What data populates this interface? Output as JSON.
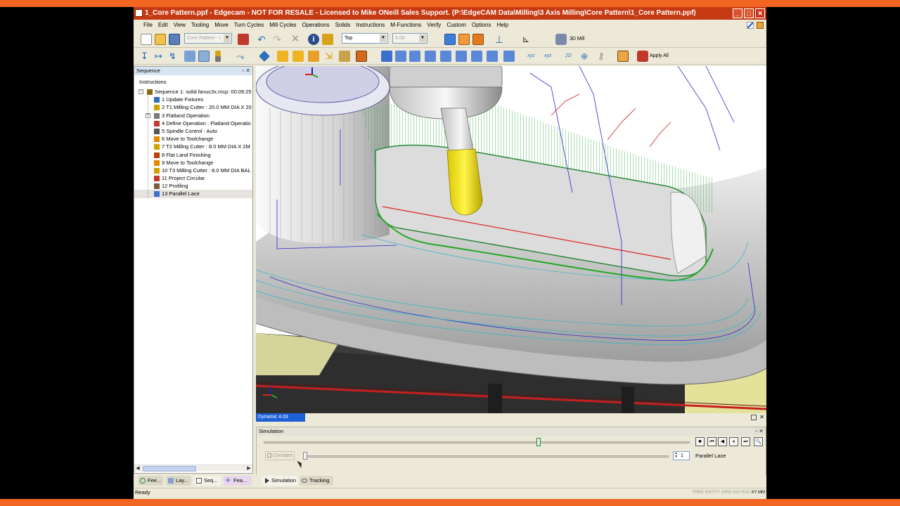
{
  "window": {
    "title": "1_Core Pattern.ppf - Edgecam - NOT FOR RESALE - Licensed to Mike ONeill Sales Support. (P:\\EdgeCAM Data\\Milling\\3 Axis Milling\\Core Pattern\\1_Core Pattern.ppf)",
    "min": "_",
    "max": "□",
    "close": "✕"
  },
  "menu": [
    "File",
    "Edit",
    "View",
    "Tooling",
    "Move",
    "Turn Cycles",
    "Mill Cycles",
    "Operations",
    "Solids",
    "Instructions",
    "M-Functions",
    "Verify",
    "Custom",
    "Options",
    "Help"
  ],
  "toolbar": {
    "layer_combo": "Core Pattern - I",
    "view_combo": "Top",
    "value_combo": "5.00",
    "env_combo": "3D Mill",
    "apply_all": "Apply All",
    "xyz1": "xyz",
    "xyz2": "xyz",
    "twod": "2D"
  },
  "sequence": {
    "title": "Sequence",
    "pin": "▫",
    "close": "✕",
    "section": "Instructions",
    "items": [
      {
        "label": "Sequence 1: solid fanuc3x.mcp: 00:09:25",
        "level": 0,
        "expander": "−",
        "icon": "sequence-icon",
        "color": "#8b6914"
      },
      {
        "label": "1 Update Fixtures",
        "level": 1,
        "expander": "",
        "icon": "fixture-icon",
        "color": "#2e6fbd"
      },
      {
        "label": "2 T1 Milling Cutter : 20.0 MM DIA X 20",
        "level": 1,
        "expander": "",
        "icon": "cutter-icon",
        "color": "#d1a100"
      },
      {
        "label": "3 Flatland Operation",
        "level": 1,
        "expander": "+",
        "icon": "operation-icon",
        "color": "#7a7a7a"
      },
      {
        "label": "4 Define Operation : Flatland Operatio",
        "level": 1,
        "expander": "",
        "icon": "define-icon",
        "color": "#c03a2b"
      },
      {
        "label": "5 Spindle Control : Auto",
        "level": 1,
        "expander": "",
        "icon": "spindle-icon",
        "color": "#555555"
      },
      {
        "label": "6 Move to Toolchange",
        "level": 1,
        "expander": "",
        "icon": "toolchange-icon",
        "color": "#e08a00"
      },
      {
        "label": "7 T2 Milling Cutter : 8.0 MM DIA X 2M",
        "level": 1,
        "expander": "",
        "icon": "cutter-icon",
        "color": "#d1a100"
      },
      {
        "label": "8 Flat Land Finishing",
        "level": 1,
        "expander": "",
        "icon": "finishing-icon",
        "color": "#b8410c"
      },
      {
        "label": "9 Move to Toolchange",
        "level": 1,
        "expander": "",
        "icon": "toolchange-icon",
        "color": "#e08a00"
      },
      {
        "label": "10 T3 Milling Cutter : 8.0 MM DIA BAL",
        "level": 1,
        "expander": "",
        "icon": "cutter-icon",
        "color": "#d1a100"
      },
      {
        "label": "11 Project Circular",
        "level": 1,
        "expander": "",
        "icon": "circular-icon",
        "color": "#c03a2b"
      },
      {
        "label": "12 Profiling",
        "level": 1,
        "expander": "",
        "icon": "profiling-icon",
        "color": "#7a5a3a"
      },
      {
        "label": "13 Parallel Lace",
        "level": 1,
        "expander": "",
        "icon": "lace-icon",
        "color": "#3a6fd0",
        "selected": true
      }
    ]
  },
  "viewport": {
    "dynamic": "Dynamic 4.03"
  },
  "simulation": {
    "title": "Simulation",
    "pin": "▫",
    "close": "✕",
    "constant_label": "Constant",
    "spin_value": "1",
    "current_op": "Parallel Lace",
    "stop": "■",
    "to_start": "⏮",
    "step_back": "◀",
    "pause": "⏸",
    "to_end": "⏭",
    "zoom": "🔍"
  },
  "tabs_left": [
    {
      "label": "Fee...",
      "icon": "feature-icon"
    },
    {
      "label": "Lay...",
      "icon": "layer-icon"
    },
    {
      "label": "Seq...",
      "icon": "sequence-tab-icon"
    },
    {
      "label": "Fea...",
      "icon": "features-icon"
    }
  ],
  "tabs_right": [
    {
      "label": "Simulation",
      "icon": "play-icon"
    },
    {
      "label": "Tracking",
      "icon": "tracking-icon"
    }
  ],
  "status": {
    "ready": "Ready",
    "flags": "FREE ENTITY GRID INS RAD",
    "units1": "XY",
    "units2": "MM"
  }
}
